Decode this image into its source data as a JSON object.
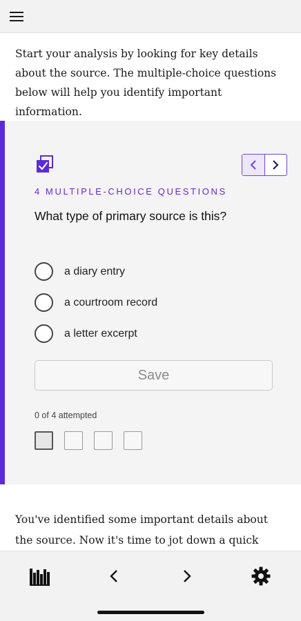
{
  "header": {
    "menu_icon": "hamburger-menu-icon"
  },
  "intro_text": "Start your analysis by looking for key details about the source. The multiple-choice questions below will help you identify important information.",
  "quiz": {
    "icon": "multiple-choice-checkbox-icon",
    "kicker": "4 MULTIPLE-CHOICE QUESTIONS",
    "question": "What type of primary source is this?",
    "options": [
      {
        "label": "a diary entry"
      },
      {
        "label": "a courtroom record"
      },
      {
        "label": "a letter excerpt"
      }
    ],
    "save_label": "Save",
    "attempted_text": "0 of 4 attempted",
    "total_questions": 4,
    "current_question": 1,
    "accent_color": "#5b2bd8"
  },
  "outro_text": "You've identified some important details about the source. Now it's time to jot down a quick summary",
  "bottom_nav": {
    "items": [
      "library-icon",
      "chevron-left-icon",
      "chevron-right-icon",
      "settings-gear-icon"
    ]
  }
}
